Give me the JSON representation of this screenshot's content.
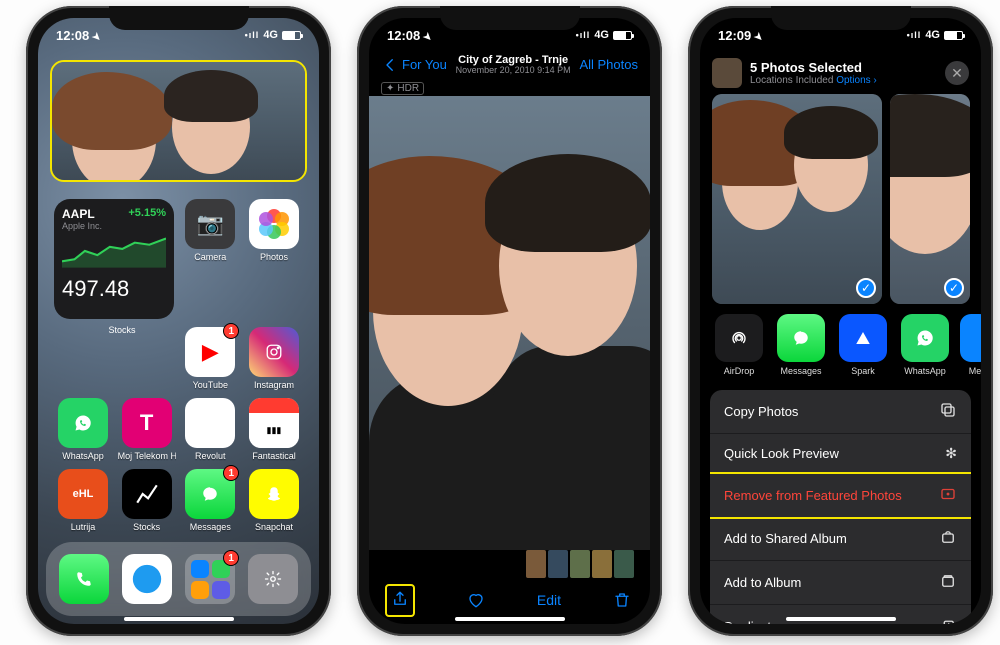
{
  "phone1": {
    "status": {
      "time": "12:08",
      "net": "4G"
    },
    "photos_widget_label": "Photos",
    "stock": {
      "symbol": "AAPL",
      "company": "Apple Inc.",
      "change_pct": "+5.15%",
      "price": "497.48",
      "label": "Stocks"
    },
    "apps": {
      "camera": "Camera",
      "photos": "Photos",
      "youtube": "YouTube",
      "instagram": "Instagram",
      "whatsapp": "WhatsApp",
      "mojtel": "Moj Telekom HR",
      "revolut": "Revolut",
      "fantastical": "Fantastical",
      "lutrija": "Lutrija",
      "stocks": "Stocks",
      "messages": "Messages",
      "snapchat": "Snapchat"
    },
    "badges": {
      "youtube": "1",
      "messages": "1",
      "applib": "1"
    }
  },
  "phone2": {
    "status": {
      "time": "12:08",
      "net": "4G"
    },
    "nav": {
      "back": "For You",
      "title": "City of Zagreb - Trnje",
      "subtitle": "November 20, 2010  9:14 PM",
      "right": "All Photos"
    },
    "hdr_label": "HDR",
    "toolbar": {
      "edit": "Edit"
    }
  },
  "phone3": {
    "status": {
      "time": "12:09",
      "net": "4G"
    },
    "sheet": {
      "title": "5 Photos Selected",
      "subtitle_prefix": "Locations Included",
      "options": "Options"
    },
    "share_targets": {
      "airdrop": "AirDrop",
      "messages": "Messages",
      "spark": "Spark",
      "whatsapp": "WhatsApp",
      "memo": "Me"
    },
    "actions": {
      "copy": "Copy Photos",
      "quicklook": "Quick Look Preview",
      "remove_featured": "Remove from Featured Photos",
      "add_shared": "Add to Shared Album",
      "add_album": "Add to Album",
      "duplicate": "Duplicate"
    }
  }
}
